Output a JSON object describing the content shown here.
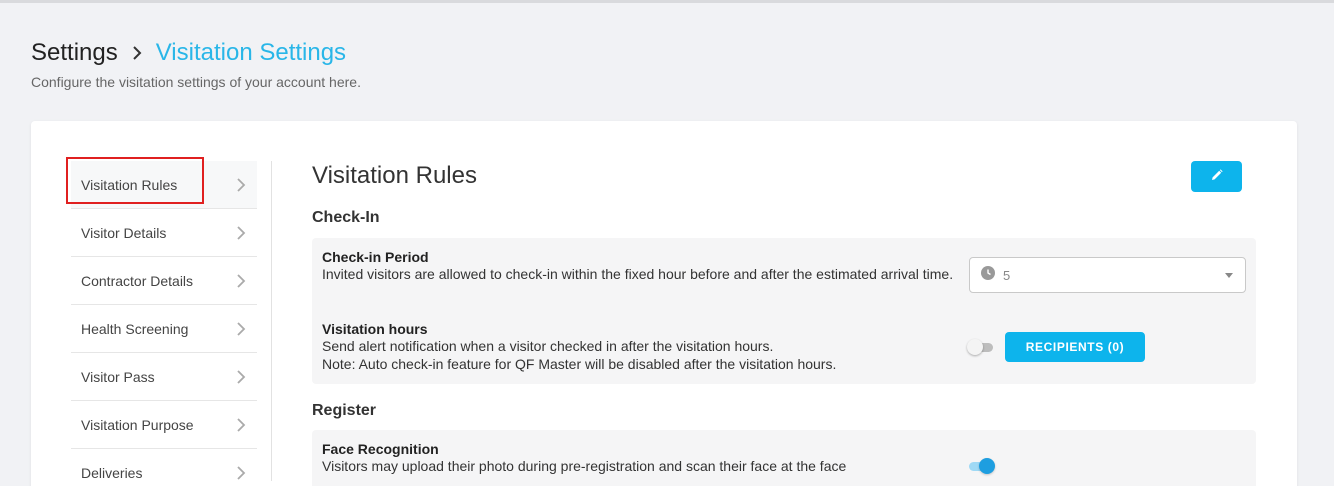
{
  "breadcrumb": {
    "root": "Settings",
    "current": "Visitation Settings"
  },
  "page": {
    "subtitle": "Configure the visitation settings of your account here."
  },
  "sidebar": {
    "items": [
      {
        "label": "Visitation Rules",
        "active": true
      },
      {
        "label": "Visitor Details"
      },
      {
        "label": "Contractor Details"
      },
      {
        "label": "Health Screening"
      },
      {
        "label": "Visitor Pass"
      },
      {
        "label": "Visitation Purpose"
      },
      {
        "label": "Deliveries"
      }
    ]
  },
  "content": {
    "title": "Visitation Rules",
    "edit_icon": "pencil-icon",
    "checkin": {
      "heading": "Check-In",
      "period": {
        "title": "Check-in Period",
        "description": "Invited visitors are allowed to check-in within the fixed hour before and after the estimated arrival time.",
        "select_icon": "clock-icon",
        "select_value": "5"
      },
      "hours": {
        "title": "Visitation hours",
        "line1": "Send alert notification when a visitor checked in after the visitation hours.",
        "line2": "Note: Auto check-in feature for QF Master will be disabled after the visitation hours.",
        "toggle_on": false,
        "recipients_label": "RECIPIENTS (0)"
      }
    },
    "register": {
      "heading": "Register",
      "face": {
        "title": "Face Recognition",
        "description": "Visitors may upload their photo during pre-registration and scan their face at the face",
        "toggle_on": true
      }
    }
  },
  "colors": {
    "accent": "#0db4ec",
    "breadcrumb_current": "#29b6e8",
    "highlight": "#e02020"
  }
}
